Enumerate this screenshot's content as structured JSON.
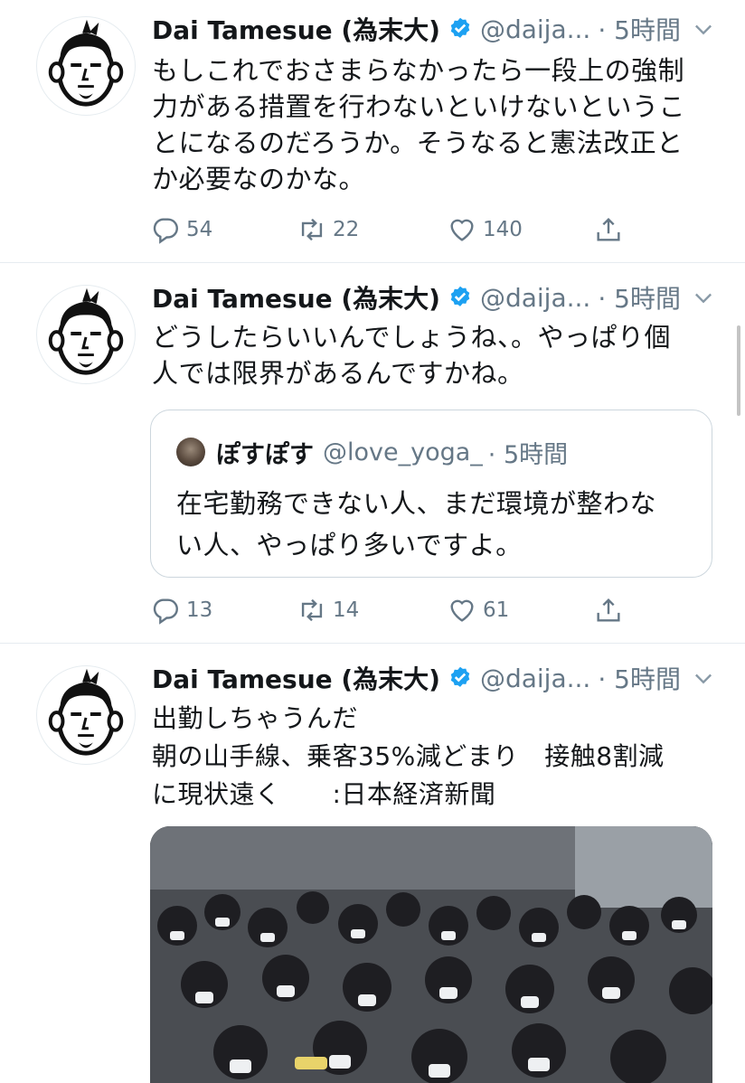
{
  "colors": {
    "text": "#14171a",
    "secondary": "#657786",
    "verified": "#1da1f2",
    "divider": "#e6ecf0"
  },
  "icons": {
    "reply": "reply-icon",
    "retweet": "retweet-icon",
    "like": "like-icon",
    "share": "share-icon",
    "caret": "chevron-down-icon",
    "verified": "verified-badge-icon"
  },
  "tweets": [
    {
      "author": "Dai Tamesue (為末大)",
      "handle": "@daija...",
      "time": "· 5時間",
      "text_lines": [
        "もしこれでおさまらなかったら一段上の強制",
        "力がある措置を行わないといけないというこ",
        "とになるのだろうか。そうなると憲法改正と",
        "か必要なのかな。"
      ],
      "replies": "54",
      "retweets": "22",
      "likes": "140"
    },
    {
      "author": "Dai Tamesue (為末大)",
      "handle": "@daija...",
      "time": "· 5時間",
      "text_lines": [
        "どうしたらいいんでしょうね、。やっぱり個",
        "人では限界があるんですかね。"
      ],
      "quote": {
        "author": "ぽすぽす",
        "handle": "@love_yoga_",
        "time": "· 5時間",
        "text_lines": [
          "在宅勤務できない人、まだ環境が整わな",
          "い人、やっぱり多いですよ。"
        ]
      },
      "replies": "13",
      "retweets": "14",
      "likes": "61"
    },
    {
      "author": "Dai Tamesue (為末大)",
      "handle": "@daija...",
      "time": "· 5時間",
      "text_lines": [
        "出勤しちゃうんだ",
        "朝の山手線、乗客35%減どまり　接触8割減",
        "に現状遠く　　:日本経済新聞"
      ]
    }
  ]
}
